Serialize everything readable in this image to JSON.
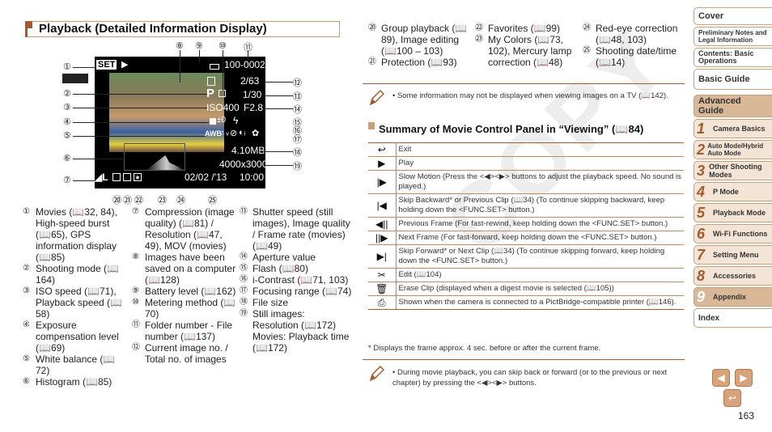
{
  "page": {
    "title": "Playback (Detailed Information Display)",
    "page_number": "163",
    "watermark": "COPY"
  },
  "screen": {
    "set_label": "SET",
    "play_icon": "play-icon",
    "folder_file": "100-0002",
    "image_count": "2/63",
    "shutter": "1/30",
    "aperture": "F2.8",
    "mode": "P",
    "iso": "ISO400",
    "exposure_comp": "±0",
    "white_balance": "AWB",
    "file_size": "4.10MB",
    "resolution": "4000x3000",
    "date": "02/02 /'13",
    "time": "10:00",
    "quality": "L"
  },
  "callouts": [
    "①",
    "②",
    "③",
    "④",
    "⑤",
    "⑥",
    "⑦",
    "⑧",
    "⑨",
    "⑩",
    "⑪",
    "⑫",
    "⑬",
    "⑭",
    "⑮",
    "⑯",
    "⑰",
    "⑱",
    "⑲",
    "⑳",
    "㉑",
    "㉒",
    "㉓",
    "㉔",
    "㉕"
  ],
  "legend": {
    "col1": [
      {
        "num": "①",
        "text": "Movies (📖32, 84), High-speed burst (📖65), GPS information display (📖85)"
      },
      {
        "num": "②",
        "text": "Shooting mode (📖164)"
      },
      {
        "num": "③",
        "text": "ISO speed (📖71), Playback speed (📖58)"
      },
      {
        "num": "④",
        "text": "Exposure compensation level (📖69)"
      },
      {
        "num": "⑤",
        "text": "White balance (📖72)"
      },
      {
        "num": "⑥",
        "text": "Histogram (📖85)"
      }
    ],
    "col2": [
      {
        "num": "⑦",
        "text": "Compression (image quality) (📖81) / Resolution (📖47, 49), MOV (movies)"
      },
      {
        "num": "⑧",
        "text": "Images have been saved on a computer (📖128)"
      },
      {
        "num": "⑨",
        "text": "Battery level (📖162)"
      },
      {
        "num": "⑩",
        "text": "Metering method (📖70)"
      },
      {
        "num": "⑪",
        "text": "Folder number - File number (📖137)"
      },
      {
        "num": "⑫",
        "text": "Current image no. / Total no. of images"
      }
    ],
    "col3": [
      {
        "num": "⑬",
        "text": "Shutter speed (still images), Image quality / Frame rate (movies) (📖49)"
      },
      {
        "num": "⑭",
        "text": "Aperture value"
      },
      {
        "num": "⑮",
        "text": "Flash (📖80)"
      },
      {
        "num": "⑯",
        "text": "i-Contrast (📖71, 103)"
      },
      {
        "num": "⑰",
        "text": "Focusing range (📖74)"
      },
      {
        "num": "⑱",
        "text": "File size"
      },
      {
        "num": "⑲",
        "text": "Still images: Resolution (📖172) Movies: Playback time (📖172)"
      }
    ],
    "colA": [
      {
        "num": "⑳",
        "text": "Group playback (📖89), Image editing (📖100 – 103)"
      },
      {
        "num": "㉑",
        "text": "Protection (📖93)"
      }
    ],
    "colB": [
      {
        "num": "㉒",
        "text": "Favorites (📖99)"
      },
      {
        "num": "㉓",
        "text": "My Colors (📖73, 102), Mercury lamp correction (📖48)"
      }
    ],
    "colC": [
      {
        "num": "㉔",
        "text": "Red-eye correction (📖48, 103)"
      },
      {
        "num": "㉕",
        "text": "Shooting date/time (📖14)"
      }
    ]
  },
  "note1": "Some information may not be displayed when viewing images on a TV (📖142).",
  "movie_panel": {
    "title": "Summary of Movie Control Panel in “Viewing” (📖84)",
    "rows": [
      {
        "icon": "↩",
        "icon_name": "exit-icon",
        "text": "Exit"
      },
      {
        "icon": "▶",
        "icon_name": "play-icon",
        "text": "Play"
      },
      {
        "icon": "|▶",
        "icon_name": "slow-motion-icon",
        "text": "Slow Motion (Press the <◀><▶> buttons to adjust the playback speed. No sound is played.)"
      },
      {
        "icon": "|◀",
        "icon_name": "skip-backward-icon",
        "text": "Skip Backward* or Previous Clip (📖34) (To continue skipping backward, keep holding down the <FUNC.SET> button.)"
      },
      {
        "icon": "◀||",
        "icon_name": "previous-frame-icon",
        "text": "Previous Frame (For fast-rewind, keep holding down the <FUNC.SET> button.)"
      },
      {
        "icon": "||▶",
        "icon_name": "next-frame-icon",
        "text": "Next Frame (For fast-forward, keep holding down the <FUNC.SET> button.)"
      },
      {
        "icon": "▶|",
        "icon_name": "skip-forward-icon",
        "text": "Skip Forward* or Next Clip (📖34) (To continue skipping forward, keep holding down the <FUNC.SET> button.)"
      },
      {
        "icon": "✂",
        "icon_name": "edit-scissors-icon",
        "text": "Edit (📖104)"
      },
      {
        "icon": "🗑",
        "icon_name": "erase-clip-icon",
        "text": "Erase Clip (displayed when a digest movie is selected (📖105))"
      },
      {
        "icon": "⎙",
        "icon_name": "print-icon",
        "text": "Shown when the camera is connected to a PictBridge-compatible printer (📖146)."
      }
    ],
    "footnote": "* Displays the frame approx. 4 sec. before or after the current frame."
  },
  "note2": "During movie playback, you can skip back or forward (or to the previous or next chapter) by pressing the <◀><▶> buttons.",
  "sidebar": {
    "cover": "Cover",
    "prelim": "Preliminary Notes and Legal Information",
    "contents": "Contents: Basic Operations",
    "basic": "Basic Guide",
    "advanced": "Advanced Guide",
    "chapters": [
      {
        "num": "1",
        "label": "Camera Basics"
      },
      {
        "num": "2",
        "label": "Auto Mode/Hybrid Auto Mode"
      },
      {
        "num": "3",
        "label": "Other Shooting Modes"
      },
      {
        "num": "4",
        "label": "P Mode"
      },
      {
        "num": "5",
        "label": "Playback Mode"
      },
      {
        "num": "6",
        "label": "Wi-Fi Functions"
      },
      {
        "num": "7",
        "label": "Setting Menu"
      },
      {
        "num": "8",
        "label": "Accessories"
      },
      {
        "num": "9",
        "label": "Appendix"
      }
    ],
    "index": "Index"
  },
  "nav": {
    "prev": "◀",
    "next": "▶",
    "back": "↩"
  }
}
